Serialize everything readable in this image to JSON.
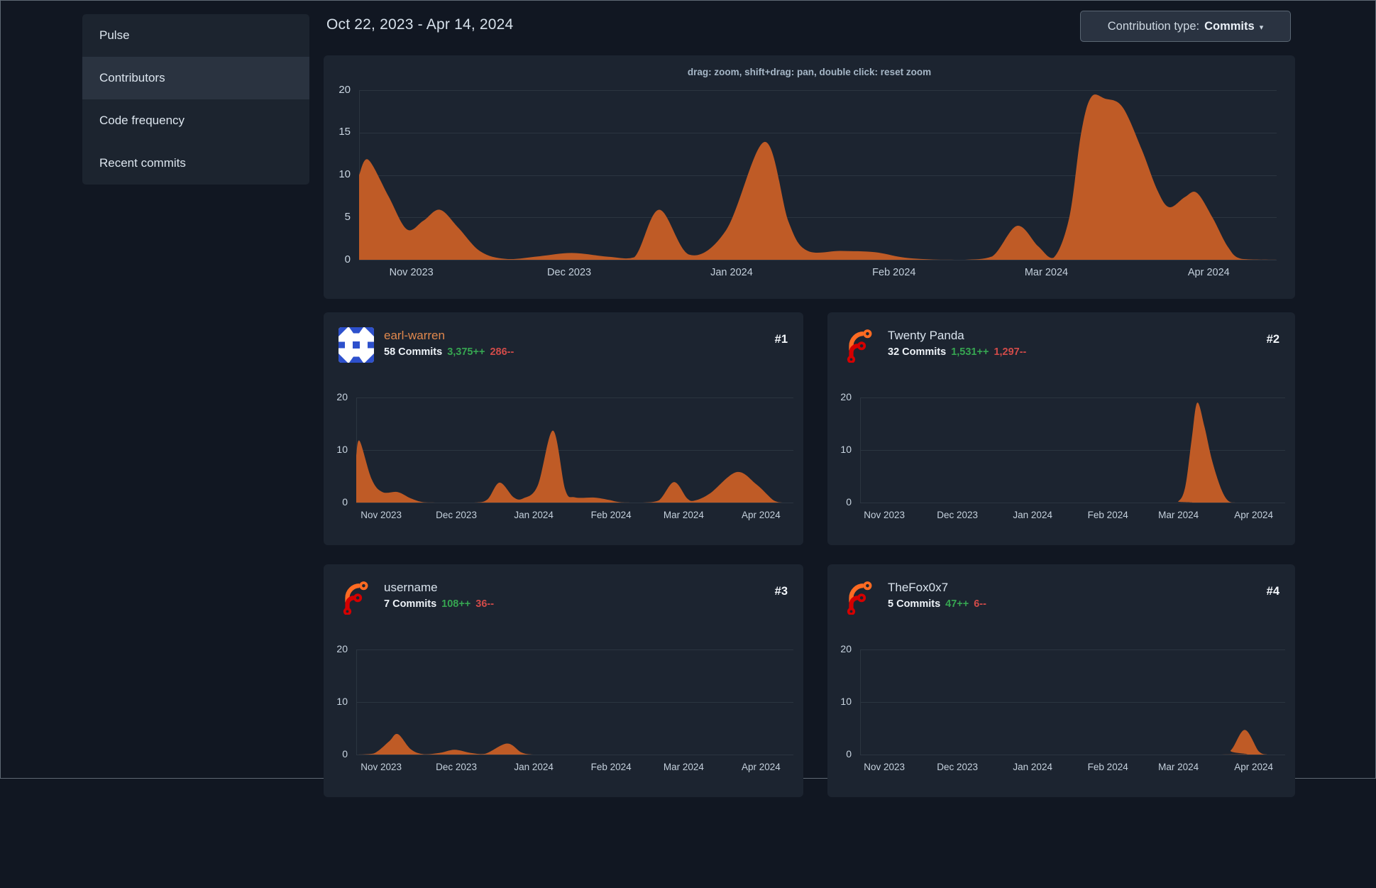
{
  "sidebar": {
    "items": [
      {
        "label": "Pulse",
        "active": false
      },
      {
        "label": "Contributors",
        "active": true
      },
      {
        "label": "Code frequency",
        "active": false
      },
      {
        "label": "Recent commits",
        "active": false
      }
    ]
  },
  "header": {
    "date_range": "Oct 22, 2023 - Apr 14, 2024",
    "contribution_type_label": "Contribution type:",
    "contribution_type_value": "Commits",
    "caret": "▾"
  },
  "main_chart_hint": "drag: zoom, shift+drag: pan, double click: reset zoom",
  "contributors": [
    {
      "rank": "#1",
      "name": "earl-warren",
      "name_color": "#e0884d",
      "avatar": "identicon-blue",
      "commits": "58 Commits",
      "additions": "3,375++",
      "deletions": "286--"
    },
    {
      "rank": "#2",
      "name": "Twenty Panda",
      "name_color": "#d9e3ed",
      "avatar": "forgejo-logo",
      "commits": "32 Commits",
      "additions": "1,531++",
      "deletions": "1,297--"
    },
    {
      "rank": "#3",
      "name": "username",
      "name_color": "#d9e3ed",
      "avatar": "forgejo-logo",
      "commits": "7 Commits",
      "additions": "108++",
      "deletions": "36--"
    },
    {
      "rank": "#4",
      "name": "TheFox0x7",
      "name_color": "#d9e3ed",
      "avatar": "forgejo-logo",
      "commits": "5 Commits",
      "additions": "47++",
      "deletions": "6--"
    }
  ],
  "colors": {
    "area_fill": "#bf5b26",
    "additions_green": "#36a651",
    "deletions_red": "#d14b49",
    "link_orange": "#e0884d",
    "panel_bg": "#1c2430",
    "page_bg": "#111722",
    "grid": "#2b3540"
  },
  "chart_data": [
    {
      "type": "area",
      "title": "All contributors commit activity",
      "x_range": [
        "Oct 22, 2023",
        "Apr 14, 2024"
      ],
      "ylim": [
        0,
        20
      ],
      "y_ticks": [
        0,
        5,
        10,
        15,
        20
      ],
      "x_ticks": [
        {
          "label": "Nov 2023",
          "f": 0.057
        },
        {
          "label": "Dec 2023",
          "f": 0.229
        },
        {
          "label": "Jan 2024",
          "f": 0.406
        },
        {
          "label": "Feb 2024",
          "f": 0.583
        },
        {
          "label": "Mar 2024",
          "f": 0.749
        },
        {
          "label": "Apr 2024",
          "f": 0.926
        }
      ],
      "points": [
        [
          0,
          10
        ],
        [
          0.01,
          11.8
        ],
        [
          0.032,
          7.5
        ],
        [
          0.052,
          3.6
        ],
        [
          0.07,
          4.6
        ],
        [
          0.088,
          5.9
        ],
        [
          0.108,
          3.8
        ],
        [
          0.132,
          1
        ],
        [
          0.16,
          0.1
        ],
        [
          0.195,
          0.4
        ],
        [
          0.232,
          0.8
        ],
        [
          0.272,
          0.35
        ],
        [
          0.3,
          0.3
        ],
        [
          0.327,
          5.9
        ],
        [
          0.36,
          0.6
        ],
        [
          0.4,
          3.5
        ],
        [
          0.442,
          13.9
        ],
        [
          0.468,
          4.5
        ],
        [
          0.488,
          1.1
        ],
        [
          0.525,
          1.05
        ],
        [
          0.562,
          0.9
        ],
        [
          0.595,
          0.25
        ],
        [
          0.63,
          0.02
        ],
        [
          0.66,
          0
        ],
        [
          0.69,
          0.4
        ],
        [
          0.717,
          4
        ],
        [
          0.74,
          1.6
        ],
        [
          0.757,
          0.25
        ],
        [
          0.774,
          5
        ],
        [
          0.787,
          15
        ],
        [
          0.798,
          19.2
        ],
        [
          0.813,
          19
        ],
        [
          0.832,
          18
        ],
        [
          0.853,
          13
        ],
        [
          0.87,
          8.2
        ],
        [
          0.883,
          6.2
        ],
        [
          0.9,
          7.4
        ],
        [
          0.913,
          7.9
        ],
        [
          0.93,
          5
        ],
        [
          0.947,
          1.5
        ],
        [
          0.962,
          0.1
        ],
        [
          1,
          0
        ]
      ]
    },
    {
      "type": "area",
      "title": "earl-warren commit activity",
      "x_range": [
        "Oct 22, 2023",
        "Apr 14, 2024"
      ],
      "ylim": [
        0,
        20
      ],
      "y_ticks": [
        0,
        10,
        20
      ],
      "x_ticks": [
        {
          "label": "Nov 2023",
          "f": 0.057
        },
        {
          "label": "Dec 2023",
          "f": 0.229
        },
        {
          "label": "Jan 2024",
          "f": 0.406
        },
        {
          "label": "Feb 2024",
          "f": 0.583
        },
        {
          "label": "Mar 2024",
          "f": 0.749
        },
        {
          "label": "Apr 2024",
          "f": 0.926
        }
      ],
      "points": [
        [
          0,
          9
        ],
        [
          0.008,
          11.7
        ],
        [
          0.035,
          4.5
        ],
        [
          0.06,
          2
        ],
        [
          0.095,
          2
        ],
        [
          0.125,
          0.8
        ],
        [
          0.155,
          0.05
        ],
        [
          0.2,
          0
        ],
        [
          0.27,
          0
        ],
        [
          0.3,
          0.6
        ],
        [
          0.328,
          3.8
        ],
        [
          0.36,
          1
        ],
        [
          0.382,
          0.8
        ],
        [
          0.415,
          3.2
        ],
        [
          0.45,
          13.7
        ],
        [
          0.478,
          2.5
        ],
        [
          0.5,
          1
        ],
        [
          0.545,
          0.95
        ],
        [
          0.578,
          0.5
        ],
        [
          0.605,
          0.05
        ],
        [
          0.655,
          0
        ],
        [
          0.692,
          0.4
        ],
        [
          0.727,
          3.9
        ],
        [
          0.757,
          0.8
        ],
        [
          0.775,
          0.4
        ],
        [
          0.81,
          1.8
        ],
        [
          0.87,
          5.8
        ],
        [
          0.915,
          3.5
        ],
        [
          0.955,
          0.4
        ],
        [
          0.975,
          0
        ],
        [
          1,
          0
        ]
      ]
    },
    {
      "type": "area",
      "title": "Twenty Panda commit activity",
      "x_range": [
        "Oct 22, 2023",
        "Apr 14, 2024"
      ],
      "ylim": [
        0,
        20
      ],
      "y_ticks": [
        0,
        10,
        20
      ],
      "x_ticks": [
        {
          "label": "Nov 2023",
          "f": 0.057
        },
        {
          "label": "Dec 2023",
          "f": 0.229
        },
        {
          "label": "Jan 2024",
          "f": 0.406
        },
        {
          "label": "Feb 2024",
          "f": 0.583
        },
        {
          "label": "Mar 2024",
          "f": 0.749
        },
        {
          "label": "Apr 2024",
          "f": 0.926
        }
      ],
      "points": [
        [
          0,
          0
        ],
        [
          0.72,
          0
        ],
        [
          0.748,
          0.2
        ],
        [
          0.765,
          3
        ],
        [
          0.78,
          12
        ],
        [
          0.793,
          19
        ],
        [
          0.81,
          14.5
        ],
        [
          0.828,
          8
        ],
        [
          0.85,
          2.5
        ],
        [
          0.868,
          0.2
        ],
        [
          0.89,
          0
        ],
        [
          1,
          0
        ]
      ]
    },
    {
      "type": "area",
      "title": "username commit activity",
      "x_range": [
        "Oct 22, 2023",
        "Apr 14, 2024"
      ],
      "ylim": [
        0,
        20
      ],
      "y_ticks": [
        0,
        10,
        20
      ],
      "x_ticks": [
        {
          "label": "Nov 2023",
          "f": 0.057
        },
        {
          "label": "Dec 2023",
          "f": 0.229
        },
        {
          "label": "Jan 2024",
          "f": 0.406
        },
        {
          "label": "Feb 2024",
          "f": 0.583
        },
        {
          "label": "Mar 2024",
          "f": 0.749
        },
        {
          "label": "Apr 2024",
          "f": 0.926
        }
      ],
      "points": [
        [
          0,
          0
        ],
        [
          0.04,
          0.2
        ],
        [
          0.075,
          2.5
        ],
        [
          0.095,
          3.9
        ],
        [
          0.125,
          1
        ],
        [
          0.155,
          0.05
        ],
        [
          0.19,
          0.3
        ],
        [
          0.225,
          0.9
        ],
        [
          0.262,
          0.3
        ],
        [
          0.295,
          0.15
        ],
        [
          0.345,
          2.1
        ],
        [
          0.378,
          0.4
        ],
        [
          0.405,
          0
        ],
        [
          0.45,
          0
        ],
        [
          1,
          0
        ]
      ]
    },
    {
      "type": "area",
      "title": "TheFox0x7 commit activity",
      "x_range": [
        "Oct 22, 2023",
        "Apr 14, 2024"
      ],
      "ylim": [
        0,
        20
      ],
      "y_ticks": [
        0,
        10,
        20
      ],
      "x_ticks": [
        {
          "label": "Nov 2023",
          "f": 0.057
        },
        {
          "label": "Dec 2023",
          "f": 0.229
        },
        {
          "label": "Jan 2024",
          "f": 0.406
        },
        {
          "label": "Feb 2024",
          "f": 0.583
        },
        {
          "label": "Mar 2024",
          "f": 0.749
        },
        {
          "label": "Apr 2024",
          "f": 0.926
        }
      ],
      "points": [
        [
          0,
          0
        ],
        [
          0.84,
          0
        ],
        [
          0.872,
          0.8
        ],
        [
          0.905,
          4.7
        ],
        [
          0.938,
          0.6
        ],
        [
          0.958,
          0
        ],
        [
          1,
          0
        ]
      ]
    }
  ]
}
